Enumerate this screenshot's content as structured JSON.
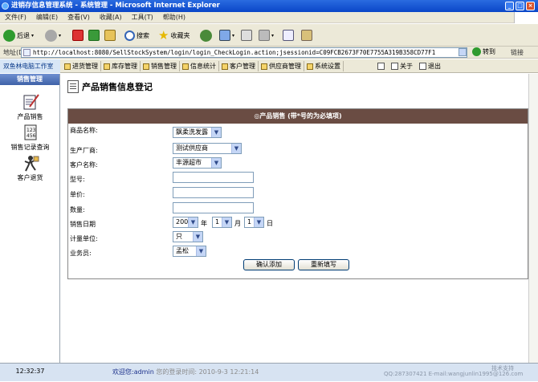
{
  "window": {
    "title": "进销存信息管理系统 - 系统管理 - Microsoft Internet Explorer"
  },
  "menu": [
    "文件(F)",
    "编辑(E)",
    "查看(V)",
    "收藏(A)",
    "工具(T)",
    "帮助(H)"
  ],
  "toolbar": {
    "back": "后退",
    "search": "搜索",
    "favorites": "收藏夹"
  },
  "address": {
    "label": "地址(D)",
    "url": "http://localhost:8080/SellStockSystem/login/login_CheckLogin.action;jsessionid=C09FCB2673F70E7755A319B358CD77F1",
    "go": "转到",
    "links": "链接"
  },
  "app": {
    "brand": "双鱼林电脑工作室"
  },
  "nav": [
    "进货管理",
    "库存管理",
    "销售管理",
    "信息统计",
    "客户管理",
    "供应商管理",
    "系统设置"
  ],
  "nav_right": [
    "关于",
    "退出"
  ],
  "sidebar": {
    "header": "销售管理",
    "items": [
      {
        "label": "产品销售",
        "icon": "pen-doc-icon"
      },
      {
        "label": "销售记录查询",
        "icon": "records-icon"
      },
      {
        "label": "客户退货",
        "icon": "return-icon"
      }
    ]
  },
  "page": {
    "title": "产品销售信息登记"
  },
  "form": {
    "header": "◎产品销售 (带*号的为必填项)",
    "product_label": "商品名称:",
    "product_value": "飘柔洗发露",
    "maker_label": "生产厂商:",
    "maker_value": "测试供应商",
    "customer_label": "客户名称:",
    "customer_value": "丰源超市",
    "model_label": "型号:",
    "price_label": "单价:",
    "qty_label": "数量:",
    "date_label": "销售日期",
    "year": "2000",
    "year_unit": "年",
    "month": "1",
    "month_unit": "月",
    "day": "1",
    "day_unit": "日",
    "unit_label": "计量单位:",
    "unit_value": "只",
    "clerk_label": "业务员:",
    "clerk_value": "孟松",
    "submit": "确认添加",
    "reset": "重新填写"
  },
  "status": {
    "time": "12:32:37",
    "welcome": "欢迎您:",
    "user": "admin",
    "last": "您的登录时间: 2010-9-3 12:21:14",
    "qq": "QQ:287307421 E-mail:wangjunlin1995@126.com",
    "support": "技术支持"
  }
}
